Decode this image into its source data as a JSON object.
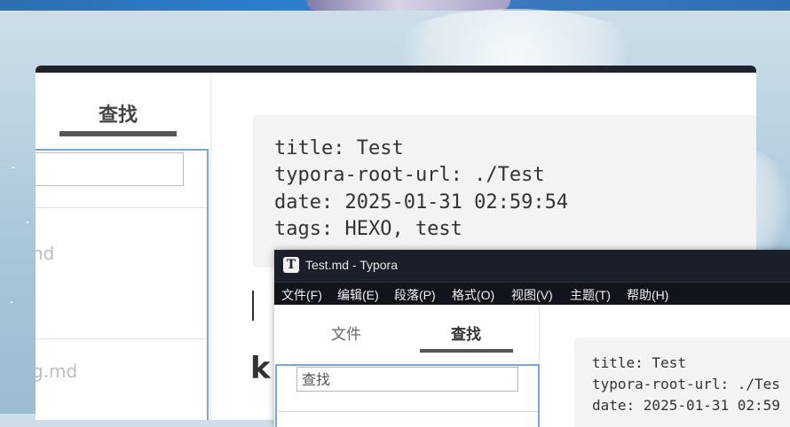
{
  "back_window": {
    "sidebar": {
      "tab_search": "查找",
      "files": [
        "nd",
        "g.md"
      ]
    },
    "frontmatter": [
      "title: Test",
      "typora-root-url: ./Test",
      "date: 2025-01-31 02:59:54",
      "tags: HEXO, test"
    ],
    "heading_fragment": "k"
  },
  "front_window": {
    "title": "Test.md - Typora",
    "app_icon": "T",
    "menu": [
      "文件(F)",
      "编辑(E)",
      "段落(P)",
      "格式(O)",
      "视图(V)",
      "主题(T)",
      "帮助(H)"
    ],
    "sidebar": {
      "tab_files": "文件",
      "tab_search": "查找",
      "search_placeholder": "查找"
    },
    "frontmatter": [
      "title: Test",
      "typora-root-url: ./Tes",
      "date: 2025-01-31 02:59"
    ]
  },
  "colors": {
    "titlebar": "#1b1f2a",
    "menubar": "#11141b",
    "focus_border": "#7aa6d6",
    "code_background": "#f3f3f3"
  }
}
